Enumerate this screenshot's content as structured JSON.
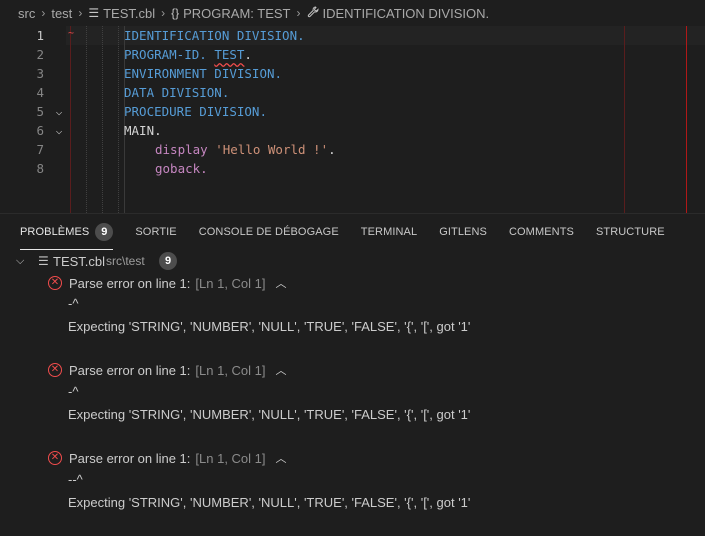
{
  "breadcrumb": {
    "items": [
      "src",
      "test",
      "TEST.cbl",
      "PROGRAM: TEST",
      "IDENTIFICATION DIVISION."
    ],
    "icons": [
      "",
      "",
      "file-lines-icon",
      "braces-icon",
      "wrench-icon"
    ],
    "separator": ">"
  },
  "editor": {
    "lines": [
      {
        "num": "1",
        "fold": ""
      },
      {
        "num": "2",
        "fold": ""
      },
      {
        "num": "3",
        "fold": ""
      },
      {
        "num": "4",
        "fold": ""
      },
      {
        "num": "5",
        "fold": "v"
      },
      {
        "num": "6",
        "fold": "v"
      },
      {
        "num": "7",
        "fold": ""
      },
      {
        "num": "8",
        "fold": ""
      }
    ],
    "code": {
      "l1": "IDENTIFICATION DIVISION.",
      "l2_a": "PROGRAM-ID. ",
      "l2_b": "TEST",
      "l2_c": ".",
      "l3": "ENVIRONMENT DIVISION.",
      "l4": "DATA DIVISION.",
      "l5": "PROCEDURE DIVISION.",
      "l6": "MAIN.",
      "l7_a": "display ",
      "l7_b": "'Hello World !'",
      "l7_c": ".",
      "l8": "goback."
    }
  },
  "panel": {
    "tabs": [
      {
        "label": "PROBLÈMES",
        "badge": "9",
        "active": true
      },
      {
        "label": "SORTIE"
      },
      {
        "label": "CONSOLE DE DÉBOGAGE"
      },
      {
        "label": "TERMINAL"
      },
      {
        "label": "GITLENS"
      },
      {
        "label": "COMMENTS"
      },
      {
        "label": "STRUCTURE"
      }
    ],
    "file": {
      "name": "TEST.cbl",
      "path": "src\\test",
      "count": "9"
    },
    "problems": [
      {
        "message": "Parse error on line 1:",
        "position": "[Ln 1, Col 1]",
        "caret": "-^",
        "detail": "Expecting 'STRING', 'NUMBER', 'NULL', 'TRUE', 'FALSE', '{', '[', got '1'"
      },
      {
        "message": "Parse error on line 1:",
        "position": "[Ln 1, Col 1]",
        "caret": "-^",
        "detail": "Expecting 'STRING', 'NUMBER', 'NULL', 'TRUE', 'FALSE', '{', '[', got '1'"
      },
      {
        "message": "Parse error on line 1:",
        "position": "[Ln 1, Col 1]",
        "caret": "--^",
        "detail": "Expecting 'STRING', 'NUMBER', 'NULL', 'TRUE', 'FALSE', '{', '[', got '1'"
      }
    ]
  },
  "colors": {
    "keyword": "#569cd6",
    "string": "#ce9178",
    "error": "#f14c4c",
    "ruler": "#5a1d1d"
  }
}
